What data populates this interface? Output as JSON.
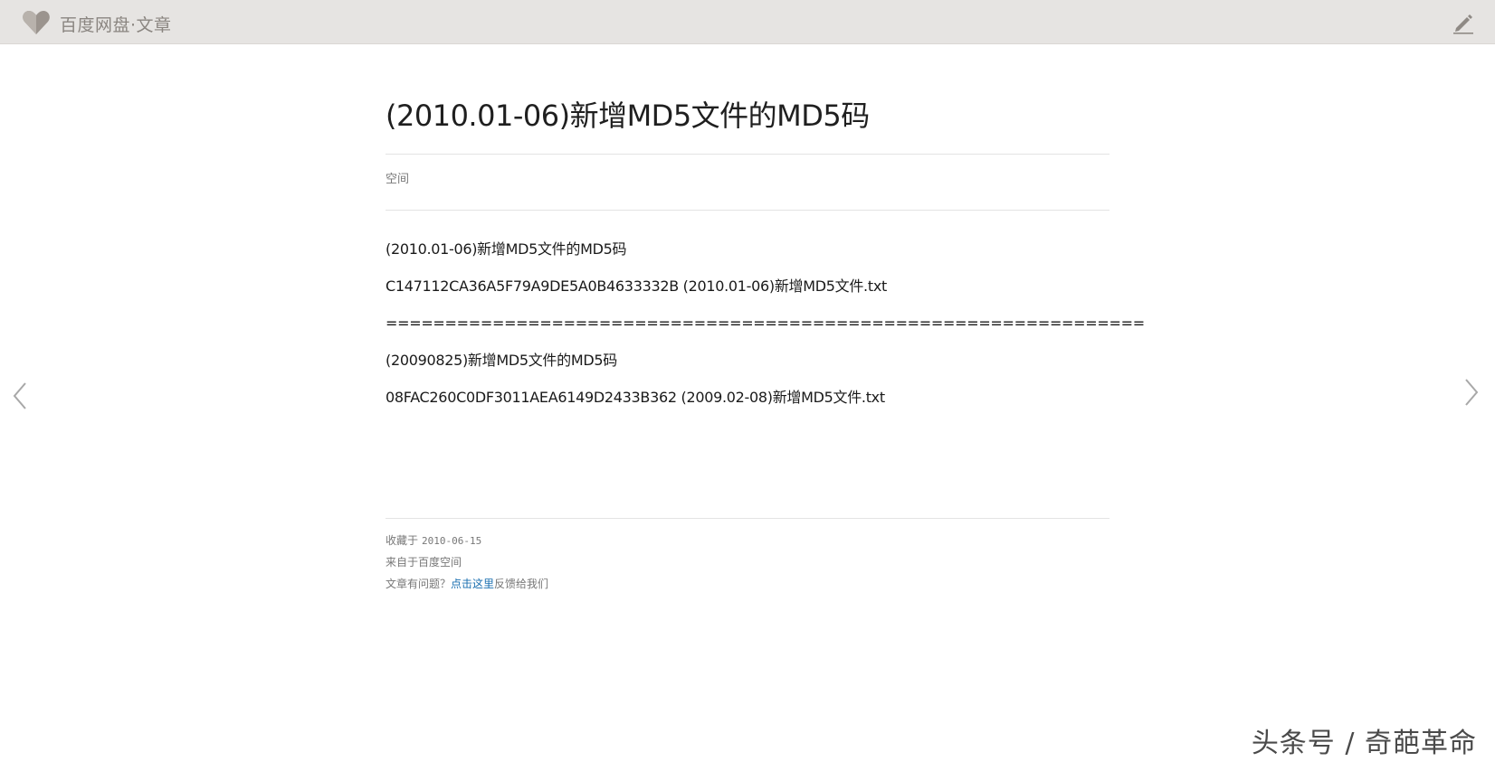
{
  "header": {
    "brand": "百度网盘·文章",
    "logo_icon": "heart-logo-icon",
    "edit_icon": "pencil-edit-icon",
    "bg_color": "#e6e4e2"
  },
  "article": {
    "title": "(2010.01-06)新增MD5文件的MD5码",
    "source": "空间",
    "lines": [
      "(2010.01-06)新增MD5文件的MD5码",
      "C147112CA36A5F79A9DE5A0B4633332B (2010.01-06)新增MD5文件.txt",
      "================================================================",
      "(20090825)新增MD5文件的MD5码",
      "08FAC260C0DF3011AEA6149D2433B362 (2009.02-08)新增MD5文件.txt"
    ]
  },
  "meta": {
    "saved_label": "收藏于",
    "saved_date": "2010-06-15",
    "from": "来自于百度空间",
    "feedback_prefix": "文章有问题？",
    "feedback_link": "点击这里",
    "feedback_suffix": "反馈给我们",
    "link_color": "#1a6fb0"
  },
  "nav": {
    "prev_icon": "chevron-left-icon",
    "next_icon": "chevron-right-icon"
  },
  "watermark": "头条号 / 奇葩革命"
}
